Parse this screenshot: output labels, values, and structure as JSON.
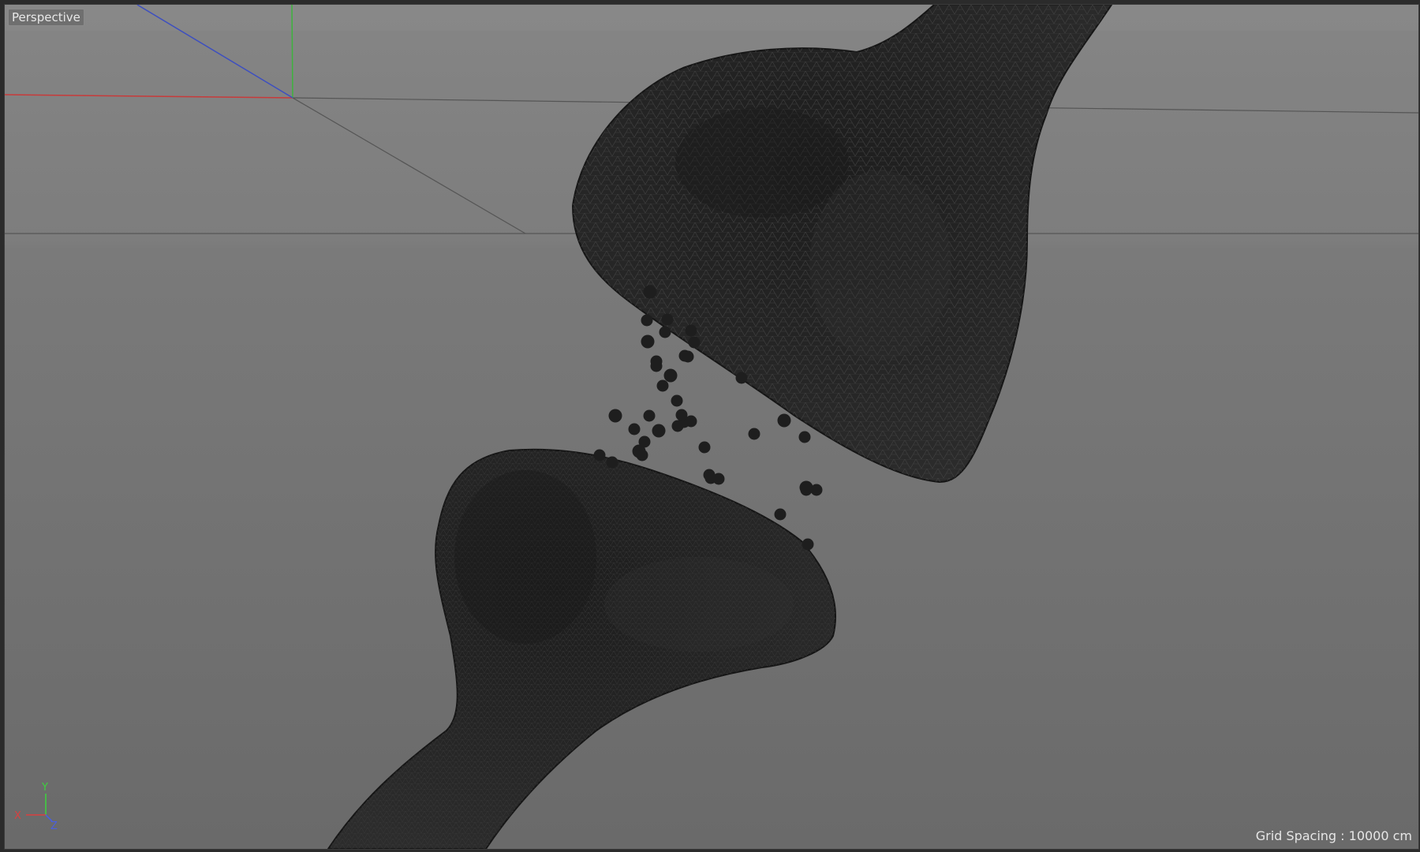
{
  "viewport": {
    "view_name": "Perspective",
    "grid_spacing_label": "Grid Spacing : 10000 cm"
  },
  "axis_gizmo": {
    "x_label": "X",
    "y_label": "Y",
    "z_label": "Z",
    "x_color": "#d94040",
    "y_color": "#3fcf3f",
    "z_color": "#4a5fe0"
  },
  "scene": {
    "mesh_color": "#262626",
    "wire_color": "#3c3c3c",
    "particle_color": "#1e1e1e",
    "particle_count": 48
  }
}
